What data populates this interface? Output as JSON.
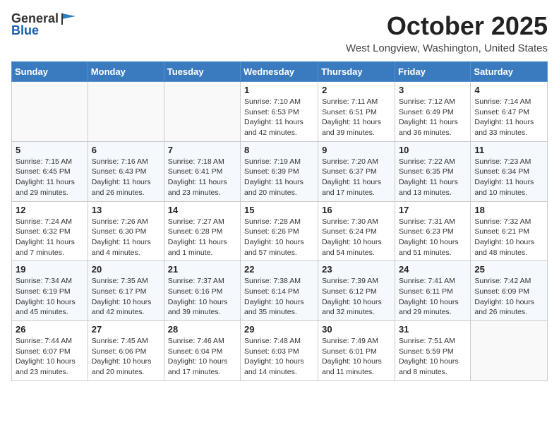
{
  "header": {
    "logo_general": "General",
    "logo_blue": "Blue",
    "month_title": "October 2025",
    "location": "West Longview, Washington, United States"
  },
  "weekdays": [
    "Sunday",
    "Monday",
    "Tuesday",
    "Wednesday",
    "Thursday",
    "Friday",
    "Saturday"
  ],
  "weeks": [
    [
      {
        "day": "",
        "info": ""
      },
      {
        "day": "",
        "info": ""
      },
      {
        "day": "",
        "info": ""
      },
      {
        "day": "1",
        "info": "Sunrise: 7:10 AM\nSunset: 6:53 PM\nDaylight: 11 hours\nand 42 minutes."
      },
      {
        "day": "2",
        "info": "Sunrise: 7:11 AM\nSunset: 6:51 PM\nDaylight: 11 hours\nand 39 minutes."
      },
      {
        "day": "3",
        "info": "Sunrise: 7:12 AM\nSunset: 6:49 PM\nDaylight: 11 hours\nand 36 minutes."
      },
      {
        "day": "4",
        "info": "Sunrise: 7:14 AM\nSunset: 6:47 PM\nDaylight: 11 hours\nand 33 minutes."
      }
    ],
    [
      {
        "day": "5",
        "info": "Sunrise: 7:15 AM\nSunset: 6:45 PM\nDaylight: 11 hours\nand 29 minutes."
      },
      {
        "day": "6",
        "info": "Sunrise: 7:16 AM\nSunset: 6:43 PM\nDaylight: 11 hours\nand 26 minutes."
      },
      {
        "day": "7",
        "info": "Sunrise: 7:18 AM\nSunset: 6:41 PM\nDaylight: 11 hours\nand 23 minutes."
      },
      {
        "day": "8",
        "info": "Sunrise: 7:19 AM\nSunset: 6:39 PM\nDaylight: 11 hours\nand 20 minutes."
      },
      {
        "day": "9",
        "info": "Sunrise: 7:20 AM\nSunset: 6:37 PM\nDaylight: 11 hours\nand 17 minutes."
      },
      {
        "day": "10",
        "info": "Sunrise: 7:22 AM\nSunset: 6:35 PM\nDaylight: 11 hours\nand 13 minutes."
      },
      {
        "day": "11",
        "info": "Sunrise: 7:23 AM\nSunset: 6:34 PM\nDaylight: 11 hours\nand 10 minutes."
      }
    ],
    [
      {
        "day": "12",
        "info": "Sunrise: 7:24 AM\nSunset: 6:32 PM\nDaylight: 11 hours\nand 7 minutes."
      },
      {
        "day": "13",
        "info": "Sunrise: 7:26 AM\nSunset: 6:30 PM\nDaylight: 11 hours\nand 4 minutes."
      },
      {
        "day": "14",
        "info": "Sunrise: 7:27 AM\nSunset: 6:28 PM\nDaylight: 11 hours\nand 1 minute."
      },
      {
        "day": "15",
        "info": "Sunrise: 7:28 AM\nSunset: 6:26 PM\nDaylight: 10 hours\nand 57 minutes."
      },
      {
        "day": "16",
        "info": "Sunrise: 7:30 AM\nSunset: 6:24 PM\nDaylight: 10 hours\nand 54 minutes."
      },
      {
        "day": "17",
        "info": "Sunrise: 7:31 AM\nSunset: 6:23 PM\nDaylight: 10 hours\nand 51 minutes."
      },
      {
        "day": "18",
        "info": "Sunrise: 7:32 AM\nSunset: 6:21 PM\nDaylight: 10 hours\nand 48 minutes."
      }
    ],
    [
      {
        "day": "19",
        "info": "Sunrise: 7:34 AM\nSunset: 6:19 PM\nDaylight: 10 hours\nand 45 minutes."
      },
      {
        "day": "20",
        "info": "Sunrise: 7:35 AM\nSunset: 6:17 PM\nDaylight: 10 hours\nand 42 minutes."
      },
      {
        "day": "21",
        "info": "Sunrise: 7:37 AM\nSunset: 6:16 PM\nDaylight: 10 hours\nand 39 minutes."
      },
      {
        "day": "22",
        "info": "Sunrise: 7:38 AM\nSunset: 6:14 PM\nDaylight: 10 hours\nand 35 minutes."
      },
      {
        "day": "23",
        "info": "Sunrise: 7:39 AM\nSunset: 6:12 PM\nDaylight: 10 hours\nand 32 minutes."
      },
      {
        "day": "24",
        "info": "Sunrise: 7:41 AM\nSunset: 6:11 PM\nDaylight: 10 hours\nand 29 minutes."
      },
      {
        "day": "25",
        "info": "Sunrise: 7:42 AM\nSunset: 6:09 PM\nDaylight: 10 hours\nand 26 minutes."
      }
    ],
    [
      {
        "day": "26",
        "info": "Sunrise: 7:44 AM\nSunset: 6:07 PM\nDaylight: 10 hours\nand 23 minutes."
      },
      {
        "day": "27",
        "info": "Sunrise: 7:45 AM\nSunset: 6:06 PM\nDaylight: 10 hours\nand 20 minutes."
      },
      {
        "day": "28",
        "info": "Sunrise: 7:46 AM\nSunset: 6:04 PM\nDaylight: 10 hours\nand 17 minutes."
      },
      {
        "day": "29",
        "info": "Sunrise: 7:48 AM\nSunset: 6:03 PM\nDaylight: 10 hours\nand 14 minutes."
      },
      {
        "day": "30",
        "info": "Sunrise: 7:49 AM\nSunset: 6:01 PM\nDaylight: 10 hours\nand 11 minutes."
      },
      {
        "day": "31",
        "info": "Sunrise: 7:51 AM\nSunset: 5:59 PM\nDaylight: 10 hours\nand 8 minutes."
      },
      {
        "day": "",
        "info": ""
      }
    ]
  ]
}
